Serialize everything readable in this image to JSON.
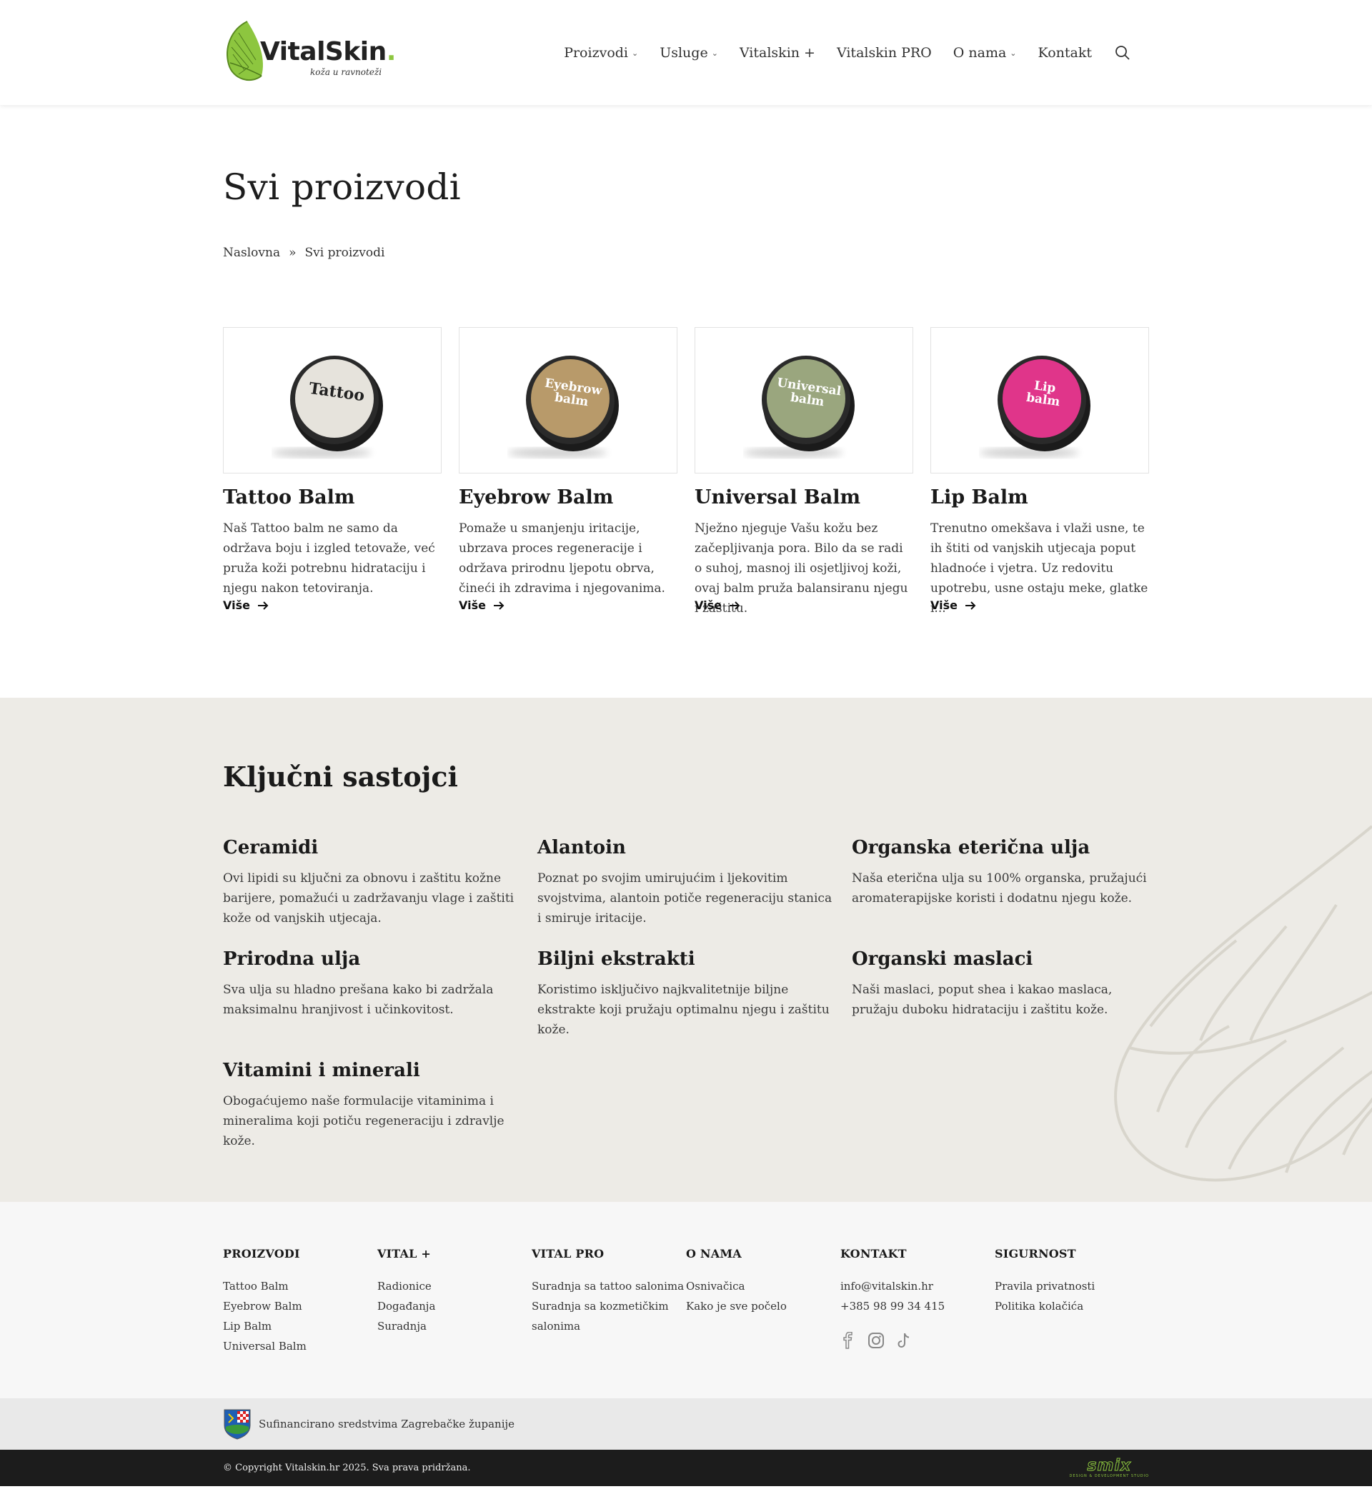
{
  "brand": {
    "name": "VitalSkin",
    "dot": ".",
    "tagline": "koža u ravnoteži"
  },
  "nav": {
    "items": [
      {
        "label": "Proizvodi",
        "has_dropdown": true
      },
      {
        "label": "Usluge",
        "has_dropdown": true
      },
      {
        "label": "Vitalskin +",
        "has_dropdown": false
      },
      {
        "label": "Vitalskin PRO",
        "has_dropdown": false
      },
      {
        "label": "O nama",
        "has_dropdown": true
      },
      {
        "label": "Kontakt",
        "has_dropdown": false
      }
    ],
    "chevron": "⌄",
    "search_icon": "search-icon"
  },
  "page": {
    "title": "Svi proizvodi",
    "breadcrumb": {
      "home": "Naslovna",
      "separator": "»",
      "current": "Svi proizvodi"
    }
  },
  "products": [
    {
      "name": "Tattoo Balm",
      "lid_label": "Tattoo",
      "lid_color": "#e6e3dc",
      "lid_text_color": "#222222",
      "description": "Naš Tattoo balm ne samo da održava boju i izgled tetovaže, već pruža koži potrebnu hidrataciju i njegu nakon tetoviranja.",
      "more": "Više"
    },
    {
      "name": "Eyebrow Balm",
      "lid_label": "Eyebrow balm",
      "lid_color": "#b89a6a",
      "lid_text_color": "#ffffff",
      "description": "Pomaže u smanjenju iritacije, ubrzava proces regeneracije i održava prirodnu ljepotu obrva, čineći ih zdravima i njegovanima.",
      "more": "Više"
    },
    {
      "name": "Universal Balm",
      "lid_label": "Universal balm",
      "lid_color": "#9aa67e",
      "lid_text_color": "#ffffff",
      "description": "Nježno njeguje Vašu kožu bez začepljivanja pora. Bilo da se radi o suhoj, masnoj ili osjetljivoj koži, ovaj balm pruža balansiranu njegu i zaštitu.",
      "more": "Više"
    },
    {
      "name": "Lip Balm",
      "lid_label": "Lip balm",
      "lid_color": "#e0358a",
      "lid_text_color": "#ffffff",
      "description": "Trenutno omekšava i vlaži usne, te ih štiti od vanjskih utjecaja poput hladnoće i vjetra. Uz redovitu upotrebu, usne ostaju meke, glatke i...",
      "more": "Više"
    }
  ],
  "ingredients": {
    "title": "Ključni sastojci",
    "items": [
      {
        "name": "Ceramidi",
        "text": "Ovi lipidi su ključni za obnovu i zaštitu kožne barijere, pomažući u zadržavanju vlage i zaštiti kože od vanjskih utjecaja."
      },
      {
        "name": "Alantoin",
        "text": "Poznat po svojim umirujućim i ljekovitim svojstvima, alantoin potiče regeneraciju stanica i smiruje iritacije."
      },
      {
        "name": "Organska eterična ulja",
        "text": "Naša eterična ulja su 100% organska, pružajući aromaterapijske koristi i dodatnu njegu kože."
      },
      {
        "name": "Prirodna ulja",
        "text": "Sva ulja su hladno prešana kako bi zadržala maksimalnu hranjivost i učinkovitost."
      },
      {
        "name": "Biljni ekstrakti",
        "text": "Koristimo isključivo najkvalitetnije biljne ekstrakte koji pružaju optimalnu njegu i zaštitu kože."
      },
      {
        "name": "Organski maslaci",
        "text": "Naši maslaci, poput shea i kakao maslaca, pružaju duboku hidrataciju i zaštitu kože."
      },
      {
        "name": "Vitamini i minerali",
        "text": "Obogaćujemo naše formulacije vitaminima i mineralima koji potiču regeneraciju i zdravlje kože."
      }
    ]
  },
  "footer": {
    "columns": [
      {
        "title": "PROIZVODI",
        "links": [
          "Tattoo Balm",
          "Eyebrow Balm",
          "Lip Balm",
          "Universal Balm"
        ]
      },
      {
        "title": "VITAL +",
        "links": [
          "Radionice",
          "Događanja",
          "Suradnja"
        ]
      },
      {
        "title": "VITAL PRO",
        "links": [
          "Suradnja sa tattoo salonima",
          "Suradnja sa kozmetičkim salonima"
        ]
      },
      {
        "title": "O NAMA",
        "links": [
          "Osnivačica",
          "Kako je sve počelo"
        ]
      },
      {
        "title": "KONTAKT",
        "links": [
          "info@vitalskin.hr",
          "+385 98 99 34 415"
        ],
        "social": [
          "facebook-icon",
          "instagram-icon",
          "tiktok-icon"
        ]
      },
      {
        "title": "SIGURNOST",
        "links": [
          "Pravila privatnosti",
          "Politika kolačića"
        ]
      }
    ],
    "cofunding": "Sufinancirano sredstvima Zagrebačke županije",
    "copyright": "© Copyright Vitalskin.hr 2025. Sva prava pridržana.",
    "studio": {
      "name": "smix",
      "sub": "DESIGN & DEVELOPMENT STUDIO"
    }
  },
  "colors": {
    "accent_green": "#8dc63f",
    "ingredients_bg": "#edebe6",
    "footer_bg": "#f7f7f7",
    "copyright_bg": "#1c1c1c"
  }
}
